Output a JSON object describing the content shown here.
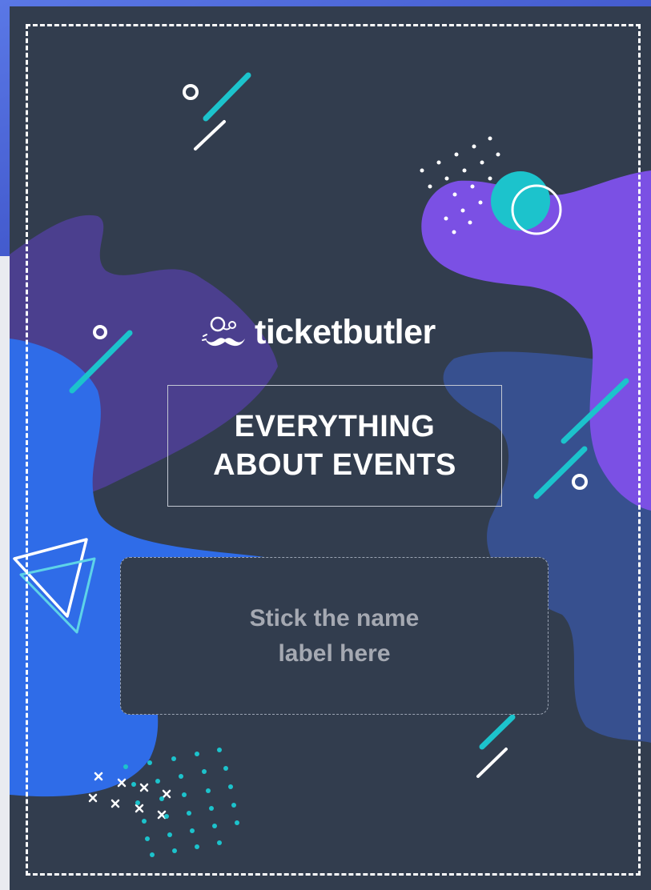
{
  "brand": {
    "name": "ticketbutler",
    "logo_icon": "butler-mustache-monocle-icon"
  },
  "headline": {
    "line1": "EVERYTHING",
    "line2": "ABOUT EVENTS"
  },
  "name_label_area": {
    "line1": "Stick the name",
    "line2": "label here"
  },
  "colors": {
    "card_background": "#323d4e",
    "accent_blue": "#2f6ce8",
    "accent_purple": "#7b50e4",
    "accent_teal": "#1cc3cc",
    "dark_violet": "#4b3f8e",
    "steel_blue": "#37508f",
    "text_white": "#ffffff",
    "label_text": "#a5a9b2"
  }
}
